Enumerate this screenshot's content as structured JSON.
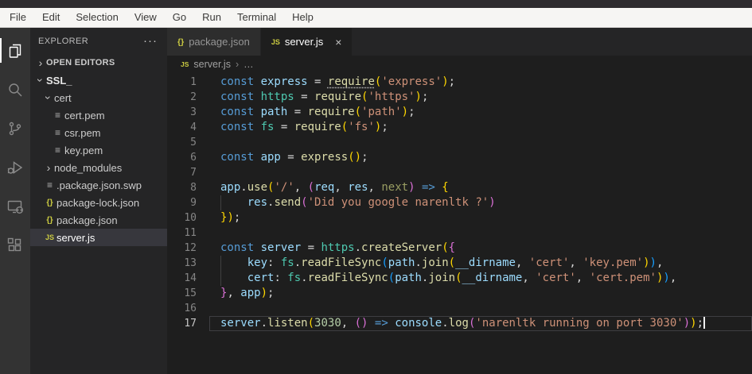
{
  "menu": {
    "items": [
      "File",
      "Edit",
      "Selection",
      "View",
      "Go",
      "Run",
      "Terminal",
      "Help"
    ]
  },
  "activity_bar": {
    "items": [
      {
        "name": "explorer",
        "active": true
      },
      {
        "name": "search",
        "active": false
      },
      {
        "name": "source-control",
        "active": false
      },
      {
        "name": "run-and-debug",
        "active": false
      },
      {
        "name": "remote-explorer",
        "active": false
      },
      {
        "name": "extensions",
        "active": false
      }
    ]
  },
  "glyphs": {
    "chevron": "›",
    "more": "···",
    "close": "×",
    "file": "≡",
    "json": "{}",
    "js": "JS",
    "breadcrumb_sep": "›",
    "breadcrumb_ellipsis": "…"
  },
  "sidebar": {
    "title": "EXPLORER",
    "open_editors": {
      "label": "OPEN EDITORS",
      "expanded": false
    },
    "tree": [
      {
        "label": "SSL_",
        "kind": "folder",
        "depth": 0,
        "expanded": true,
        "bold": true
      },
      {
        "label": "cert",
        "kind": "folder",
        "depth": 1,
        "expanded": true
      },
      {
        "label": "cert.pem",
        "kind": "file",
        "icon": "file",
        "depth": 2
      },
      {
        "label": "csr.pem",
        "kind": "file",
        "icon": "file",
        "depth": 2
      },
      {
        "label": "key.pem",
        "kind": "file",
        "icon": "file",
        "depth": 2
      },
      {
        "label": "node_modules",
        "kind": "folder",
        "depth": 1,
        "expanded": false
      },
      {
        "label": ".package.json.swp",
        "kind": "file",
        "icon": "file",
        "depth": 1
      },
      {
        "label": "package-lock.json",
        "kind": "file",
        "icon": "json",
        "depth": 1
      },
      {
        "label": "package.json",
        "kind": "file",
        "icon": "json",
        "depth": 1
      },
      {
        "label": "server.js",
        "kind": "file",
        "icon": "js",
        "depth": 1,
        "selected": true
      }
    ]
  },
  "tabs": [
    {
      "label": "package.json",
      "icon": "json",
      "active": false,
      "close": false
    },
    {
      "label": "server.js",
      "icon": "js",
      "active": true,
      "close": true
    }
  ],
  "breadcrumb": {
    "icon_label": "JS",
    "file": "server.js"
  },
  "editor": {
    "language": "javascript",
    "lines": [
      {
        "n": 1,
        "tokens": [
          {
            "t": "const ",
            "c": "kw"
          },
          {
            "t": "express",
            "c": "var"
          },
          {
            "t": " = ",
            "c": "p"
          },
          {
            "t": "require",
            "c": "fn u"
          },
          {
            "t": "(",
            "c": "b1"
          },
          {
            "t": "'express'",
            "c": "str"
          },
          {
            "t": ")",
            "c": "b1"
          },
          {
            "t": ";",
            "c": "p"
          }
        ]
      },
      {
        "n": 2,
        "tokens": [
          {
            "t": "const ",
            "c": "kw"
          },
          {
            "t": "https",
            "c": "mod"
          },
          {
            "t": " = ",
            "c": "p"
          },
          {
            "t": "require",
            "c": "fn"
          },
          {
            "t": "(",
            "c": "b1"
          },
          {
            "t": "'https'",
            "c": "str"
          },
          {
            "t": ")",
            "c": "b1"
          },
          {
            "t": ";",
            "c": "p"
          }
        ]
      },
      {
        "n": 3,
        "tokens": [
          {
            "t": "const ",
            "c": "kw"
          },
          {
            "t": "path",
            "c": "var"
          },
          {
            "t": " = ",
            "c": "p"
          },
          {
            "t": "require",
            "c": "fn"
          },
          {
            "t": "(",
            "c": "b1"
          },
          {
            "t": "'path'",
            "c": "str"
          },
          {
            "t": ")",
            "c": "b1"
          },
          {
            "t": ";",
            "c": "p"
          }
        ]
      },
      {
        "n": 4,
        "tokens": [
          {
            "t": "const ",
            "c": "kw"
          },
          {
            "t": "fs",
            "c": "mod"
          },
          {
            "t": " = ",
            "c": "p"
          },
          {
            "t": "require",
            "c": "fn"
          },
          {
            "t": "(",
            "c": "b1"
          },
          {
            "t": "'fs'",
            "c": "str"
          },
          {
            "t": ")",
            "c": "b1"
          },
          {
            "t": ";",
            "c": "p"
          }
        ]
      },
      {
        "n": 5,
        "tokens": []
      },
      {
        "n": 6,
        "tokens": [
          {
            "t": "const ",
            "c": "kw"
          },
          {
            "t": "app",
            "c": "var"
          },
          {
            "t": " = ",
            "c": "p"
          },
          {
            "t": "express",
            "c": "fn"
          },
          {
            "t": "(",
            "c": "b1"
          },
          {
            "t": ")",
            "c": "b1"
          },
          {
            "t": ";",
            "c": "p"
          }
        ]
      },
      {
        "n": 7,
        "tokens": []
      },
      {
        "n": 8,
        "tokens": [
          {
            "t": "app",
            "c": "var"
          },
          {
            "t": ".",
            "c": "p"
          },
          {
            "t": "use",
            "c": "fn"
          },
          {
            "t": "(",
            "c": "b1"
          },
          {
            "t": "'/'",
            "c": "str"
          },
          {
            "t": ", ",
            "c": "p"
          },
          {
            "t": "(",
            "c": "b2"
          },
          {
            "t": "req",
            "c": "var"
          },
          {
            "t": ", ",
            "c": "p"
          },
          {
            "t": "res",
            "c": "var"
          },
          {
            "t": ", ",
            "c": "p"
          },
          {
            "t": "next",
            "c": "dim"
          },
          {
            "t": ")",
            "c": "b2"
          },
          {
            "t": " ",
            "c": "p"
          },
          {
            "t": "=>",
            "c": "kw"
          },
          {
            "t": " ",
            "c": "p"
          },
          {
            "t": "{",
            "c": "b1"
          }
        ]
      },
      {
        "n": 9,
        "guide": true,
        "tokens": [
          {
            "t": "    ",
            "c": "p"
          },
          {
            "t": "res",
            "c": "var"
          },
          {
            "t": ".",
            "c": "p"
          },
          {
            "t": "send",
            "c": "fn"
          },
          {
            "t": "(",
            "c": "b2"
          },
          {
            "t": "'Did you google narenltk ?'",
            "c": "str"
          },
          {
            "t": ")",
            "c": "b2"
          }
        ]
      },
      {
        "n": 10,
        "tokens": [
          {
            "t": "}",
            "c": "b1"
          },
          {
            "t": ")",
            "c": "b1"
          },
          {
            "t": ";",
            "c": "p"
          }
        ]
      },
      {
        "n": 11,
        "tokens": []
      },
      {
        "n": 12,
        "tokens": [
          {
            "t": "const ",
            "c": "kw"
          },
          {
            "t": "server",
            "c": "var"
          },
          {
            "t": " = ",
            "c": "p"
          },
          {
            "t": "https",
            "c": "mod"
          },
          {
            "t": ".",
            "c": "p"
          },
          {
            "t": "createServer",
            "c": "fn"
          },
          {
            "t": "(",
            "c": "b1"
          },
          {
            "t": "{",
            "c": "b2"
          }
        ]
      },
      {
        "n": 13,
        "guide": true,
        "tokens": [
          {
            "t": "    ",
            "c": "p"
          },
          {
            "t": "key",
            "c": "var"
          },
          {
            "t": ": ",
            "c": "p"
          },
          {
            "t": "fs",
            "c": "mod"
          },
          {
            "t": ".",
            "c": "p"
          },
          {
            "t": "readFileSync",
            "c": "fn"
          },
          {
            "t": "(",
            "c": "b3"
          },
          {
            "t": "path",
            "c": "var"
          },
          {
            "t": ".",
            "c": "p"
          },
          {
            "t": "join",
            "c": "fn"
          },
          {
            "t": "(",
            "c": "b1"
          },
          {
            "t": "__dirname",
            "c": "var"
          },
          {
            "t": ", ",
            "c": "p"
          },
          {
            "t": "'cert'",
            "c": "str"
          },
          {
            "t": ", ",
            "c": "p"
          },
          {
            "t": "'key.pem'",
            "c": "str"
          },
          {
            "t": ")",
            "c": "b1"
          },
          {
            "t": ")",
            "c": "b3"
          },
          {
            "t": ",",
            "c": "p"
          }
        ]
      },
      {
        "n": 14,
        "guide": true,
        "tokens": [
          {
            "t": "    ",
            "c": "p"
          },
          {
            "t": "cert",
            "c": "var"
          },
          {
            "t": ": ",
            "c": "p"
          },
          {
            "t": "fs",
            "c": "mod"
          },
          {
            "t": ".",
            "c": "p"
          },
          {
            "t": "readFileSync",
            "c": "fn"
          },
          {
            "t": "(",
            "c": "b3"
          },
          {
            "t": "path",
            "c": "var"
          },
          {
            "t": ".",
            "c": "p"
          },
          {
            "t": "join",
            "c": "fn"
          },
          {
            "t": "(",
            "c": "b1"
          },
          {
            "t": "__dirname",
            "c": "var"
          },
          {
            "t": ", ",
            "c": "p"
          },
          {
            "t": "'cert'",
            "c": "str"
          },
          {
            "t": ", ",
            "c": "p"
          },
          {
            "t": "'cert.pem'",
            "c": "str"
          },
          {
            "t": ")",
            "c": "b1"
          },
          {
            "t": ")",
            "c": "b3"
          },
          {
            "t": ",",
            "c": "p"
          }
        ]
      },
      {
        "n": 15,
        "tokens": [
          {
            "t": "}",
            "c": "b2"
          },
          {
            "t": ", ",
            "c": "p"
          },
          {
            "t": "app",
            "c": "var"
          },
          {
            "t": ")",
            "c": "b1"
          },
          {
            "t": ";",
            "c": "p"
          }
        ]
      },
      {
        "n": 16,
        "tokens": []
      },
      {
        "n": 17,
        "current": true,
        "cursor": true,
        "tokens": [
          {
            "t": "server",
            "c": "var"
          },
          {
            "t": ".",
            "c": "p"
          },
          {
            "t": "listen",
            "c": "fn"
          },
          {
            "t": "(",
            "c": "b1"
          },
          {
            "t": "3030",
            "c": "num"
          },
          {
            "t": ", ",
            "c": "p"
          },
          {
            "t": "(",
            "c": "b2"
          },
          {
            "t": ")",
            "c": "b2"
          },
          {
            "t": " ",
            "c": "p"
          },
          {
            "t": "=>",
            "c": "kw"
          },
          {
            "t": " ",
            "c": "p"
          },
          {
            "t": "console",
            "c": "var"
          },
          {
            "t": ".",
            "c": "p"
          },
          {
            "t": "log",
            "c": "fn"
          },
          {
            "t": "(",
            "c": "b2"
          },
          {
            "t": "'narenltk running on port 3030'",
            "c": "str"
          },
          {
            "t": ")",
            "c": "b2"
          },
          {
            "t": ")",
            "c": "b1"
          },
          {
            "t": ";",
            "c": "p"
          }
        ]
      }
    ]
  },
  "colors": {
    "editor_bg": "#1e1e1e",
    "sidebar_bg": "#252526",
    "activitybar_bg": "#333333",
    "menubar_bg": "#f6f5f3",
    "selected_row_bg": "#37373d",
    "inactive_tab_bg": "#2d2d2d",
    "keyword": "#569cd6",
    "variable": "#9cdcfe",
    "module": "#4ec9b0",
    "function": "#dcdcaa",
    "string": "#ce9178",
    "number": "#b5cea8",
    "plain": "#d4d4d4",
    "bracket_gold": "#ffd700",
    "bracket_purple": "#da70d6",
    "bracket_blue": "#179fff",
    "unused_param": "#999d62",
    "file_type_yellow": "#cbcb41"
  }
}
